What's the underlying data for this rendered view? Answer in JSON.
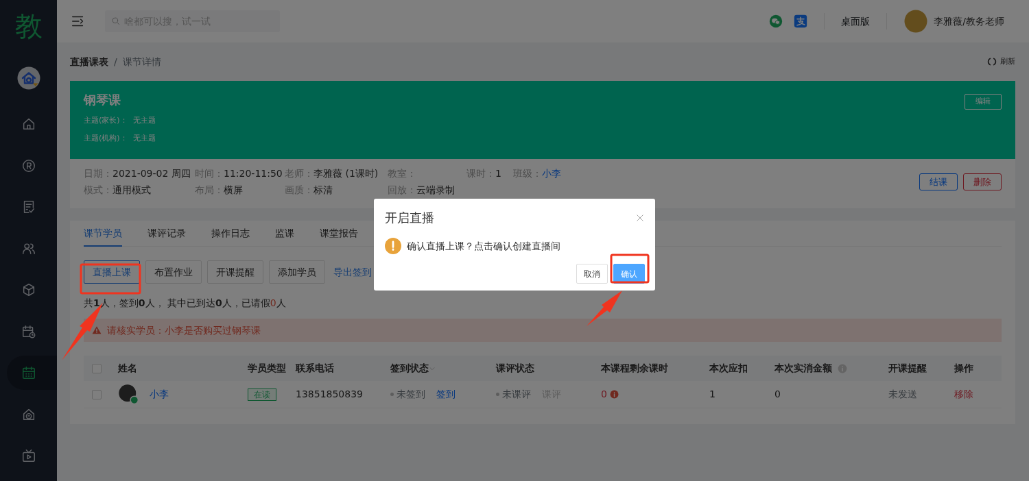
{
  "sidebar": {
    "logo": "教",
    "items": [
      {
        "selected": false
      },
      {
        "selected": false
      },
      {
        "selected": false
      },
      {
        "selected": false
      },
      {
        "selected": false
      },
      {
        "selected": false
      },
      {
        "selected": true
      },
      {
        "selected": false
      },
      {
        "selected": false
      }
    ]
  },
  "topbar": {
    "search": {
      "placeholder": "啥都可以搜，试一试"
    },
    "desktop_link": "桌面版",
    "user": "李雅薇/教务老师"
  },
  "breadcrumb": {
    "items": [
      "直播课表",
      "课节详情"
    ],
    "separator": "/",
    "refresh": "刷新"
  },
  "lesson": {
    "title": "钢琴课",
    "topics": [
      {
        "label": "主题(家长)：",
        "value": "无主题"
      },
      {
        "label": "主题(机构)：",
        "value": "无主题"
      }
    ],
    "edit_button": "编辑",
    "fields": [
      {
        "label": "日期：",
        "value": "2021-09-02 周四",
        "kind": "text"
      },
      {
        "label": "时间：",
        "value": "11:20-11:50",
        "kind": "text"
      },
      {
        "label": "老师：",
        "value": "李雅薇 (1课时)",
        "kind": "text"
      },
      {
        "label": "教室："
      },
      {
        "label": "课时：",
        "value": "1",
        "kind": "text"
      },
      {
        "label": "班级：",
        "value": "小李",
        "kind": "link"
      },
      {
        "label": "模式：",
        "value": "通用模式",
        "kind": "text"
      },
      {
        "label": "布局：",
        "value": "横屏",
        "kind": "text"
      },
      {
        "label": "画质：",
        "value": "标清",
        "kind": "text"
      },
      {
        "label": "回放：",
        "value": "云端录制",
        "kind": "text"
      }
    ],
    "actions": [
      {
        "label": "结课",
        "kind": "primary"
      },
      {
        "label": "删除",
        "kind": "danger"
      }
    ]
  },
  "tabs": [
    {
      "label": "课节学员",
      "selected": true
    },
    {
      "label": "课评记录",
      "selected": false
    },
    {
      "label": "操作日志",
      "selected": false
    },
    {
      "label": "监课",
      "selected": false
    },
    {
      "label": "课堂报告",
      "selected": false
    }
  ],
  "toolbar": [
    {
      "label": "直播上课",
      "kind": "primary"
    },
    {
      "label": "布置作业",
      "kind": "default"
    },
    {
      "label": "开课提醒",
      "kind": "default"
    },
    {
      "label": "添加学员",
      "kind": "default"
    },
    {
      "label": "导出签到",
      "kind": "link"
    }
  ],
  "summary": [
    {
      "text": "共",
      "kind": "plain"
    },
    {
      "text": "1",
      "kind": "bold"
    },
    {
      "text": "人，签到",
      "kind": "plain"
    },
    {
      "text": "0",
      "kind": "bold"
    },
    {
      "text": "人， 其中已到达",
      "kind": "plain"
    },
    {
      "text": "0",
      "kind": "bold"
    },
    {
      "text": "人，已请假",
      "kind": "plain"
    },
    {
      "text": "0",
      "kind": "alert"
    },
    {
      "text": "人",
      "kind": "plain"
    }
  ],
  "alert": "请核实学员：小李是否购买过钢琴课",
  "table": {
    "all_checked": false,
    "columns": [
      {
        "label": "姓名"
      },
      {
        "label": "学员类型"
      },
      {
        "label": "联系电话"
      },
      {
        "label": "签到状态",
        "sortable": true
      },
      {
        "label": "课评状态"
      },
      {
        "label": "本课程剩余课时"
      },
      {
        "label": "本次应扣"
      },
      {
        "label": "本次实消金额",
        "info": true
      },
      {
        "label": "开课提醒"
      },
      {
        "label": "操作"
      }
    ],
    "rows": [
      {
        "checked": false,
        "name": "小李",
        "type": "在读",
        "phone": "13851850839",
        "checkin_status": "未签到",
        "checkin_action": "签到",
        "review_status": "未课评",
        "review_action": "课评",
        "remaining": "0",
        "deduct": "1",
        "amount": "0",
        "reminder": "未发送",
        "action": "移除"
      }
    ]
  },
  "dialog": {
    "title": "开启直播",
    "message": "确认直播上课？点击确认创建直播间",
    "buttons": [
      {
        "label": "取消",
        "kind": "default"
      },
      {
        "label": "确认",
        "kind": "primary"
      }
    ]
  }
}
